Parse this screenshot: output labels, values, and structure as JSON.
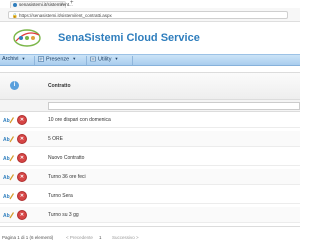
{
  "browser": {
    "tab_title": "senasistemi.it/sistemi/ent...",
    "tab_close": "×",
    "new_tab": "+",
    "url": "https://senasistemi.it/sistemi/ent_contratti.aspx"
  },
  "app": {
    "title": "SenaSistemi Cloud Service"
  },
  "menu": {
    "items": [
      {
        "label": "Archivi",
        "icon": "archive-icon"
      },
      {
        "label": "Presenze",
        "icon": "attendance-icon"
      },
      {
        "label": "Utility",
        "icon": "utility-icon"
      }
    ],
    "arrow": "▼"
  },
  "grid": {
    "info_icon_glyph": "i",
    "column_header": "Contratto",
    "delete_glyph": "✕",
    "rows": [
      "10 ore dispari con domenica",
      "5 ORE",
      "Nuovo Contratto",
      "Turno 36 ore feci",
      "Turno Sera",
      "Turno su 3 gg"
    ]
  },
  "pager": {
    "info": "Pagina 1 di 1 (6 elementi)",
    "prev": "< Precedente",
    "page": "1",
    "next": "Successivo >"
  },
  "colors": {
    "accent": "#2f7ebd",
    "menu_bg": "#b9d8f3",
    "delete": "#d64545"
  }
}
